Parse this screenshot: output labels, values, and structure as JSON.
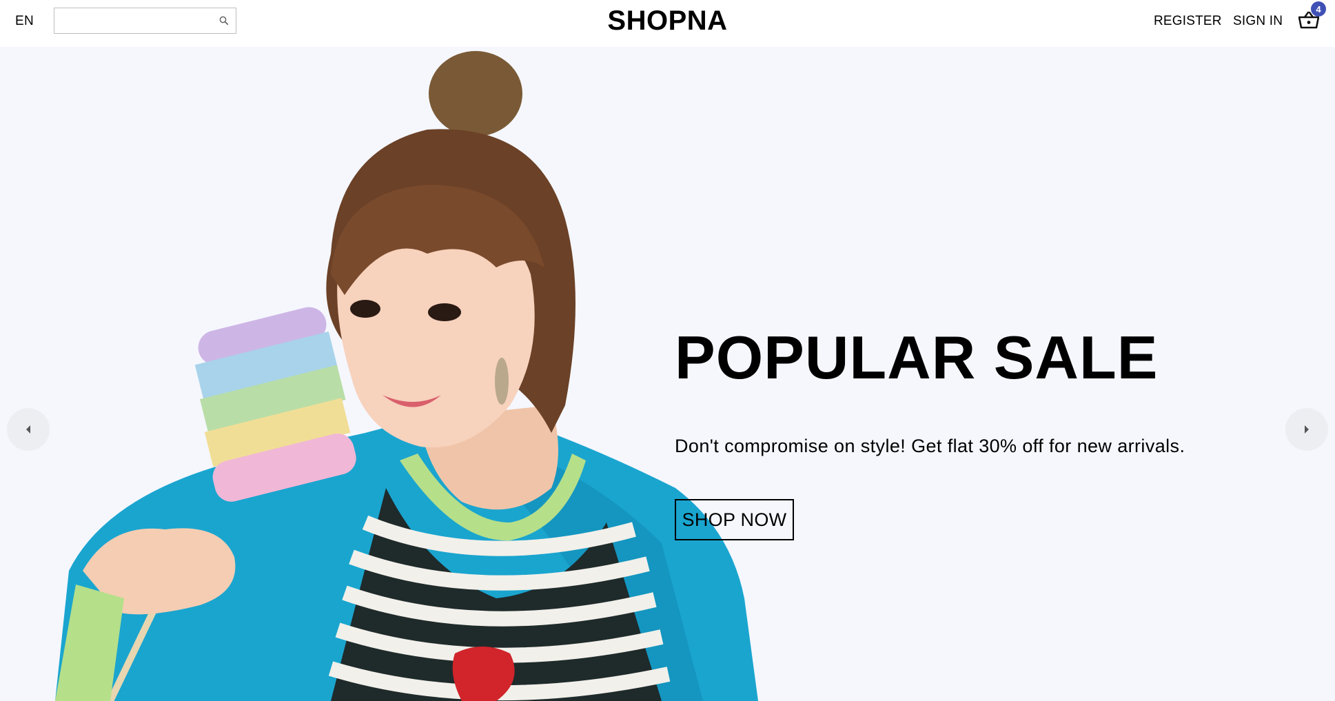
{
  "navbar": {
    "language": "EN",
    "search": {
      "placeholder": "",
      "value": "",
      "icon": "search-icon"
    },
    "logo": "SHOPNA",
    "links": {
      "register": "REGISTER",
      "sign_in": "SIGN IN"
    },
    "cart": {
      "icon": "cart-icon",
      "count": "4",
      "badge_color": "#3f51b5"
    }
  },
  "slider": {
    "background_color": "#f5f7fd",
    "slide": {
      "title": "POPULAR SALE",
      "description": "Don't compromise on style! Get flat 30% off for new arrivals.",
      "cta_label": "SHOP NOW"
    },
    "prev_icon": "arrow-left-icon",
    "next_icon": "arrow-right-icon"
  }
}
